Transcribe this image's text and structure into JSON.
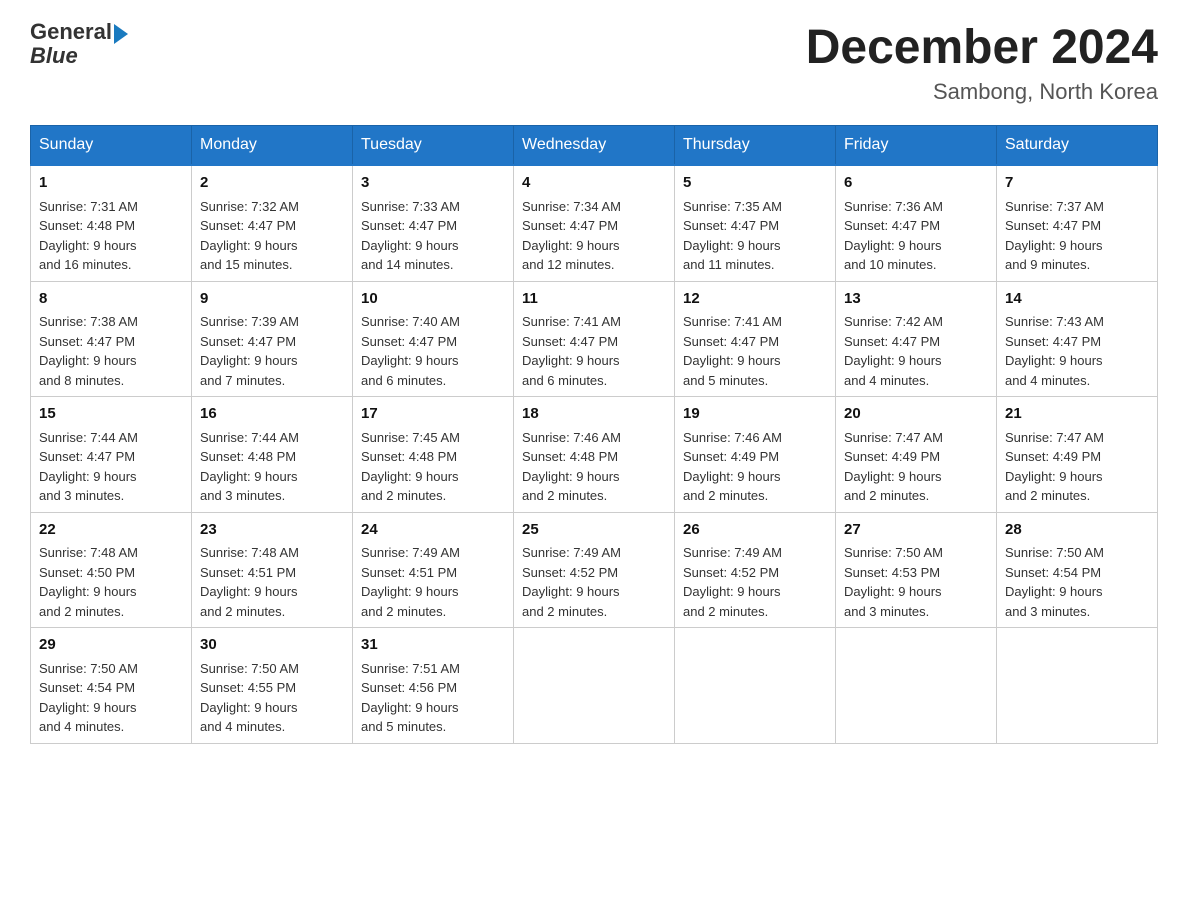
{
  "header": {
    "logo_text_general": "General",
    "logo_text_blue": "Blue",
    "month_title": "December 2024",
    "location": "Sambong, North Korea"
  },
  "days_of_week": [
    "Sunday",
    "Monday",
    "Tuesday",
    "Wednesday",
    "Thursday",
    "Friday",
    "Saturday"
  ],
  "weeks": [
    [
      {
        "day": "1",
        "sunrise": "7:31 AM",
        "sunset": "4:48 PM",
        "daylight": "9 hours and 16 minutes."
      },
      {
        "day": "2",
        "sunrise": "7:32 AM",
        "sunset": "4:47 PM",
        "daylight": "9 hours and 15 minutes."
      },
      {
        "day": "3",
        "sunrise": "7:33 AM",
        "sunset": "4:47 PM",
        "daylight": "9 hours and 14 minutes."
      },
      {
        "day": "4",
        "sunrise": "7:34 AM",
        "sunset": "4:47 PM",
        "daylight": "9 hours and 12 minutes."
      },
      {
        "day": "5",
        "sunrise": "7:35 AM",
        "sunset": "4:47 PM",
        "daylight": "9 hours and 11 minutes."
      },
      {
        "day": "6",
        "sunrise": "7:36 AM",
        "sunset": "4:47 PM",
        "daylight": "9 hours and 10 minutes."
      },
      {
        "day": "7",
        "sunrise": "7:37 AM",
        "sunset": "4:47 PM",
        "daylight": "9 hours and 9 minutes."
      }
    ],
    [
      {
        "day": "8",
        "sunrise": "7:38 AM",
        "sunset": "4:47 PM",
        "daylight": "9 hours and 8 minutes."
      },
      {
        "day": "9",
        "sunrise": "7:39 AM",
        "sunset": "4:47 PM",
        "daylight": "9 hours and 7 minutes."
      },
      {
        "day": "10",
        "sunrise": "7:40 AM",
        "sunset": "4:47 PM",
        "daylight": "9 hours and 6 minutes."
      },
      {
        "day": "11",
        "sunrise": "7:41 AM",
        "sunset": "4:47 PM",
        "daylight": "9 hours and 6 minutes."
      },
      {
        "day": "12",
        "sunrise": "7:41 AM",
        "sunset": "4:47 PM",
        "daylight": "9 hours and 5 minutes."
      },
      {
        "day": "13",
        "sunrise": "7:42 AM",
        "sunset": "4:47 PM",
        "daylight": "9 hours and 4 minutes."
      },
      {
        "day": "14",
        "sunrise": "7:43 AM",
        "sunset": "4:47 PM",
        "daylight": "9 hours and 4 minutes."
      }
    ],
    [
      {
        "day": "15",
        "sunrise": "7:44 AM",
        "sunset": "4:47 PM",
        "daylight": "9 hours and 3 minutes."
      },
      {
        "day": "16",
        "sunrise": "7:44 AM",
        "sunset": "4:48 PM",
        "daylight": "9 hours and 3 minutes."
      },
      {
        "day": "17",
        "sunrise": "7:45 AM",
        "sunset": "4:48 PM",
        "daylight": "9 hours and 2 minutes."
      },
      {
        "day": "18",
        "sunrise": "7:46 AM",
        "sunset": "4:48 PM",
        "daylight": "9 hours and 2 minutes."
      },
      {
        "day": "19",
        "sunrise": "7:46 AM",
        "sunset": "4:49 PM",
        "daylight": "9 hours and 2 minutes."
      },
      {
        "day": "20",
        "sunrise": "7:47 AM",
        "sunset": "4:49 PM",
        "daylight": "9 hours and 2 minutes."
      },
      {
        "day": "21",
        "sunrise": "7:47 AM",
        "sunset": "4:49 PM",
        "daylight": "9 hours and 2 minutes."
      }
    ],
    [
      {
        "day": "22",
        "sunrise": "7:48 AM",
        "sunset": "4:50 PM",
        "daylight": "9 hours and 2 minutes."
      },
      {
        "day": "23",
        "sunrise": "7:48 AM",
        "sunset": "4:51 PM",
        "daylight": "9 hours and 2 minutes."
      },
      {
        "day": "24",
        "sunrise": "7:49 AM",
        "sunset": "4:51 PM",
        "daylight": "9 hours and 2 minutes."
      },
      {
        "day": "25",
        "sunrise": "7:49 AM",
        "sunset": "4:52 PM",
        "daylight": "9 hours and 2 minutes."
      },
      {
        "day": "26",
        "sunrise": "7:49 AM",
        "sunset": "4:52 PM",
        "daylight": "9 hours and 2 minutes."
      },
      {
        "day": "27",
        "sunrise": "7:50 AM",
        "sunset": "4:53 PM",
        "daylight": "9 hours and 3 minutes."
      },
      {
        "day": "28",
        "sunrise": "7:50 AM",
        "sunset": "4:54 PM",
        "daylight": "9 hours and 3 minutes."
      }
    ],
    [
      {
        "day": "29",
        "sunrise": "7:50 AM",
        "sunset": "4:54 PM",
        "daylight": "9 hours and 4 minutes."
      },
      {
        "day": "30",
        "sunrise": "7:50 AM",
        "sunset": "4:55 PM",
        "daylight": "9 hours and 4 minutes."
      },
      {
        "day": "31",
        "sunrise": "7:51 AM",
        "sunset": "4:56 PM",
        "daylight": "9 hours and 5 minutes."
      },
      null,
      null,
      null,
      null
    ]
  ]
}
